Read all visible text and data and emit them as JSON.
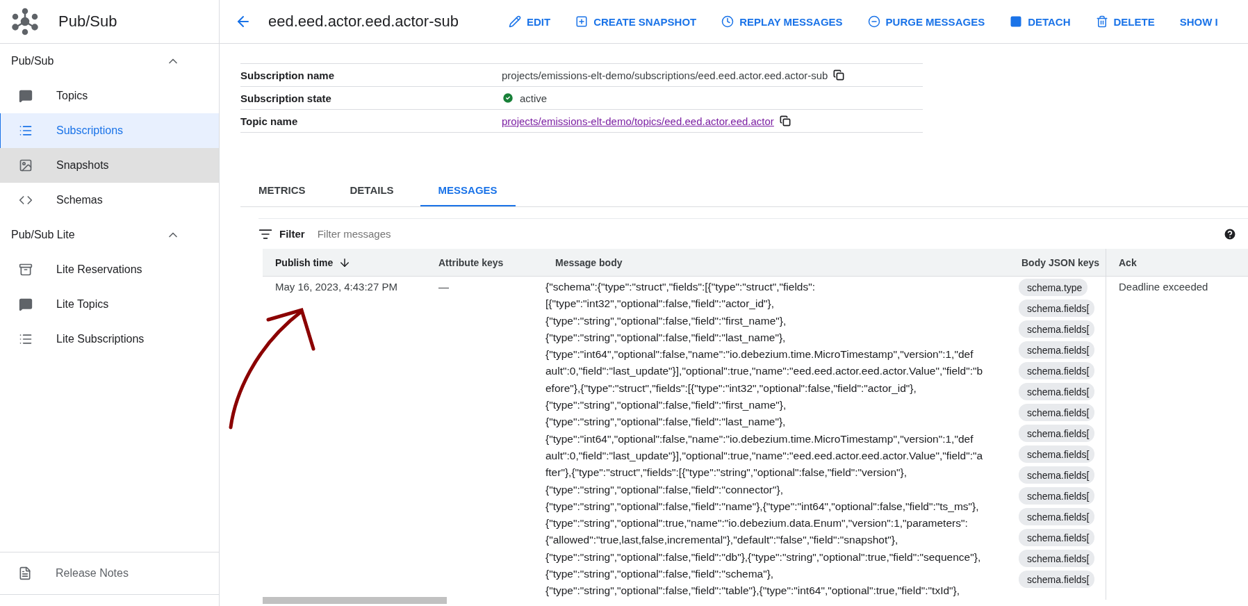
{
  "app": {
    "title": "Pub/Sub"
  },
  "sidebar": {
    "sections": [
      {
        "title": "Pub/Sub",
        "expanded": true,
        "items": [
          {
            "label": "Topics",
            "selected": false,
            "hovered": false
          },
          {
            "label": "Subscriptions",
            "selected": true,
            "hovered": false
          },
          {
            "label": "Snapshots",
            "selected": false,
            "hovered": true
          },
          {
            "label": "Schemas",
            "selected": false,
            "hovered": false
          }
        ]
      },
      {
        "title": "Pub/Sub Lite",
        "expanded": true,
        "items": [
          {
            "label": "Lite Reservations",
            "selected": false,
            "hovered": false
          },
          {
            "label": "Lite Topics",
            "selected": false,
            "hovered": false
          },
          {
            "label": "Lite Subscriptions",
            "selected": false,
            "hovered": false
          }
        ]
      }
    ],
    "footer": {
      "label": "Release Notes"
    }
  },
  "header": {
    "title": "eed.eed.actor.eed.actor-sub",
    "actions": [
      {
        "label": "EDIT"
      },
      {
        "label": "CREATE SNAPSHOT"
      },
      {
        "label": "REPLAY MESSAGES"
      },
      {
        "label": "PURGE MESSAGES"
      },
      {
        "label": "DETACH"
      },
      {
        "label": "DELETE"
      },
      {
        "label": "SHOW I"
      }
    ]
  },
  "details": [
    {
      "label": "Subscription name",
      "kind": "copy",
      "value": "projects/emissions-elt-demo/subscriptions/eed.eed.actor.eed.actor-sub"
    },
    {
      "label": "Subscription state",
      "kind": "status",
      "value": "active"
    },
    {
      "label": "Topic name",
      "kind": "link",
      "value": "projects/emissions-elt-demo/topics/eed.eed.actor.eed.actor"
    }
  ],
  "tabs": [
    {
      "label": "METRICS",
      "selected": false
    },
    {
      "label": "DETAILS",
      "selected": false
    },
    {
      "label": "MESSAGES",
      "selected": true
    }
  ],
  "filter": {
    "label": "Filter",
    "placeholder": "Filter messages"
  },
  "table": {
    "columns": [
      {
        "label": "Publish time",
        "sorted": true
      },
      {
        "label": "Attribute keys",
        "sorted": false
      },
      {
        "label": "Message body",
        "sorted": false
      },
      {
        "label": "Body JSON keys",
        "sorted": false
      },
      {
        "label": "Ack",
        "sorted": false
      }
    ],
    "rows": [
      {
        "publish_time": "May 16, 2023, 4:43:27 PM",
        "attribute_keys": "—",
        "ack": "Deadline exceeded",
        "message_body": [
          "{\"schema\":{\"type\":\"struct\",\"fields\":[{\"type\":\"struct\",\"fields\":",
          "[{\"type\":\"int32\",\"optional\":false,\"field\":\"actor_id\"},",
          "{\"type\":\"string\",\"optional\":false,\"field\":\"first_name\"},",
          "{\"type\":\"string\",\"optional\":false,\"field\":\"last_name\"},",
          "{\"type\":\"int64\",\"optional\":false,\"name\":\"io.debezium.time.MicroTimestamp\",\"version\":1,\"def",
          "ault\":0,\"field\":\"last_update\"}],\"optional\":true,\"name\":\"eed.eed.actor.eed.actor.Value\",\"field\":\"b",
          "efore\"},{\"type\":\"struct\",\"fields\":[{\"type\":\"int32\",\"optional\":false,\"field\":\"actor_id\"},",
          "{\"type\":\"string\",\"optional\":false,\"field\":\"first_name\"},",
          "{\"type\":\"string\",\"optional\":false,\"field\":\"last_name\"},",
          "{\"type\":\"int64\",\"optional\":false,\"name\":\"io.debezium.time.MicroTimestamp\",\"version\":1,\"def",
          "ault\":0,\"field\":\"last_update\"}],\"optional\":true,\"name\":\"eed.eed.actor.eed.actor.Value\",\"field\":\"a",
          "fter\"},{\"type\":\"struct\",\"fields\":[{\"type\":\"string\",\"optional\":false,\"field\":\"version\"},",
          "{\"type\":\"string\",\"optional\":false,\"field\":\"connector\"},",
          "{\"type\":\"string\",\"optional\":false,\"field\":\"name\"},{\"type\":\"int64\",\"optional\":false,\"field\":\"ts_ms\"},",
          "{\"type\":\"string\",\"optional\":true,\"name\":\"io.debezium.data.Enum\",\"version\":1,\"parameters\":",
          "{\"allowed\":\"true,last,false,incremental\"},\"default\":\"false\",\"field\":\"snapshot\"},",
          "{\"type\":\"string\",\"optional\":false,\"field\":\"db\"},{\"type\":\"string\",\"optional\":true,\"field\":\"sequence\"},",
          "{\"type\":\"string\",\"optional\":false,\"field\":\"schema\"},",
          "{\"type\":\"string\",\"optional\":false,\"field\":\"table\"},{\"type\":\"int64\",\"optional\":true,\"field\":\"txId\"},"
        ],
        "body_json_keys": [
          "schema.type",
          "schema.fields[",
          "schema.fields[",
          "schema.fields[",
          "schema.fields[",
          "schema.fields[",
          "schema.fields[",
          "schema.fields[",
          "schema.fields[",
          "schema.fields[",
          "schema.fields[",
          "schema.fields[",
          "schema.fields[",
          "schema.fields[",
          "schema.fields["
        ]
      }
    ]
  }
}
